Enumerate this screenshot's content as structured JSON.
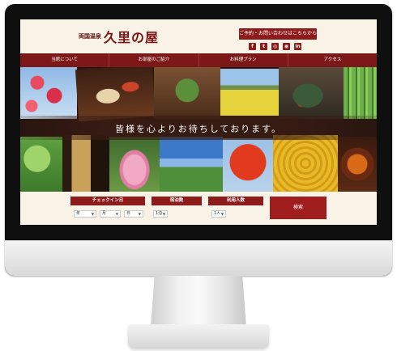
{
  "header": {
    "logo_small": "両国温泉",
    "logo_big": "久里の屋",
    "reserve_label": "ご予約・お問い合わせはこちらから",
    "social": [
      "f",
      "t",
      "◎",
      "◉",
      "in"
    ]
  },
  "nav": {
    "items": [
      "当館について",
      "お部屋のご紹介",
      "お料理プラン",
      "アクセス"
    ]
  },
  "hero": {
    "tagline": "皆様を心よりお待ちしております。"
  },
  "booking": {
    "checkin_label": "チェックイン日",
    "nights_label": "宿泊数",
    "guests_label": "利用人数",
    "year_value": "年",
    "month_value": "月",
    "day_value": "日",
    "nights_value": "1泊",
    "guests_value": "1人",
    "search_label": "検索"
  }
}
